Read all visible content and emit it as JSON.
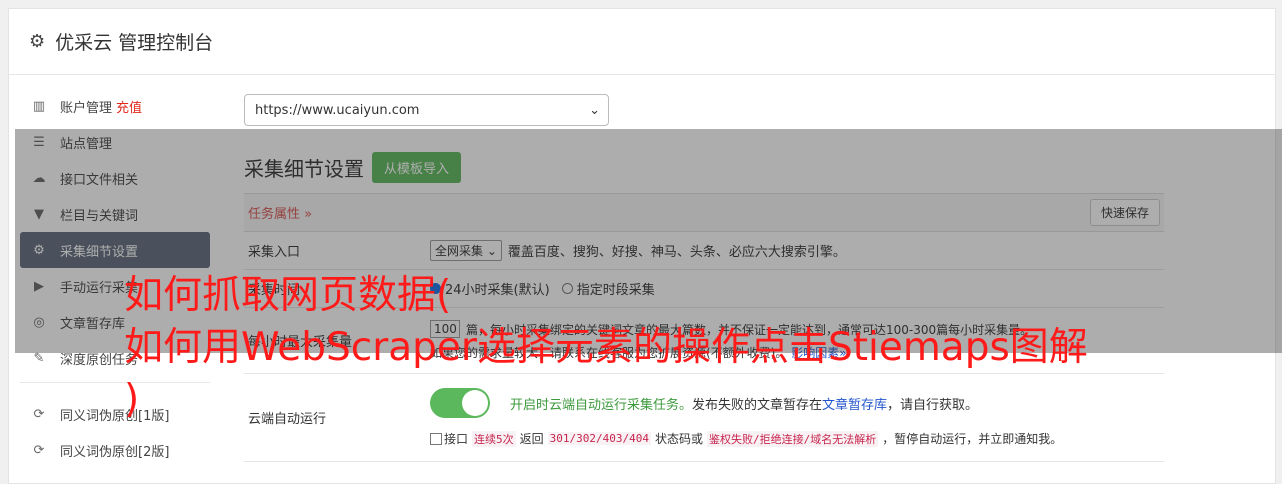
{
  "header": {
    "title": "优采云 管理控制台"
  },
  "sidebar": {
    "items": [
      {
        "label": "账户管理",
        "extra": "充值",
        "icon": "bar-chart-icon"
      },
      {
        "label": "站点管理",
        "icon": "server-icon"
      },
      {
        "label": "接口文件相关",
        "icon": "cloud-upload-icon"
      },
      {
        "label": "栏目与关键词",
        "icon": "filter-icon"
      },
      {
        "label": "采集细节设置",
        "icon": "cogs-icon",
        "active": true
      },
      {
        "label": "手动运行采集",
        "icon": "play-icon"
      },
      {
        "label": "文章暂存库",
        "icon": "database-icon"
      },
      {
        "label": "深度原创任务",
        "icon": "edit-icon"
      },
      {
        "label": "同义词伪原创[1版]",
        "icon": "refresh-icon"
      },
      {
        "label": "同义词伪原创[2版]",
        "icon": "refresh-icon"
      }
    ]
  },
  "main": {
    "site_select": "https://www.ucaiyun.com",
    "section_title": "采集细节设置",
    "import_button": "从模板导入",
    "task_props": "任务属性 »",
    "quick_save": "快速保存",
    "rows": {
      "entry": {
        "label": "采集入口",
        "select": "全网采集",
        "desc": "覆盖百度、搜狗、好搜、神马、头条、必应六大搜索引擎。"
      },
      "time": {
        "label": "采集时间",
        "opt1": "24小时采集(默认)",
        "opt2": "指定时段采集"
      },
      "max": {
        "label": "每小时最大采集量",
        "value": "100",
        "desc1": "篇，每小时采集绑定的关键词文章的最大篇数，并不保证一定能达到，通常可达100-300篇每小时采集量。",
        "desc2": "如果您的需求量较大，请联系在线客服为您扩展资源(不额外收费)。",
        "link": "影响因素»"
      },
      "cloud": {
        "label": "云端自动运行",
        "green": "开启时云端自动运行采集任务。",
        "text1": "发布失败的文章暂存在",
        "link": "文章暂存库",
        "text2": "，请自行获取。",
        "cb_label": "接口",
        "code1": "连续5次",
        "t3": "返回",
        "code2": "301/302/403/404",
        "t4": "状态码或",
        "code3": "鉴权失败/拒绝连接/域名无法解析",
        "t5": "，暂停自动运行，并立即通知我。"
      }
    }
  },
  "watermark": {
    "line1": "如何抓取网页数据(",
    "line2": "如何用WebScraper选择元素的操作点击Stiemaps图解",
    "line3": ")"
  }
}
